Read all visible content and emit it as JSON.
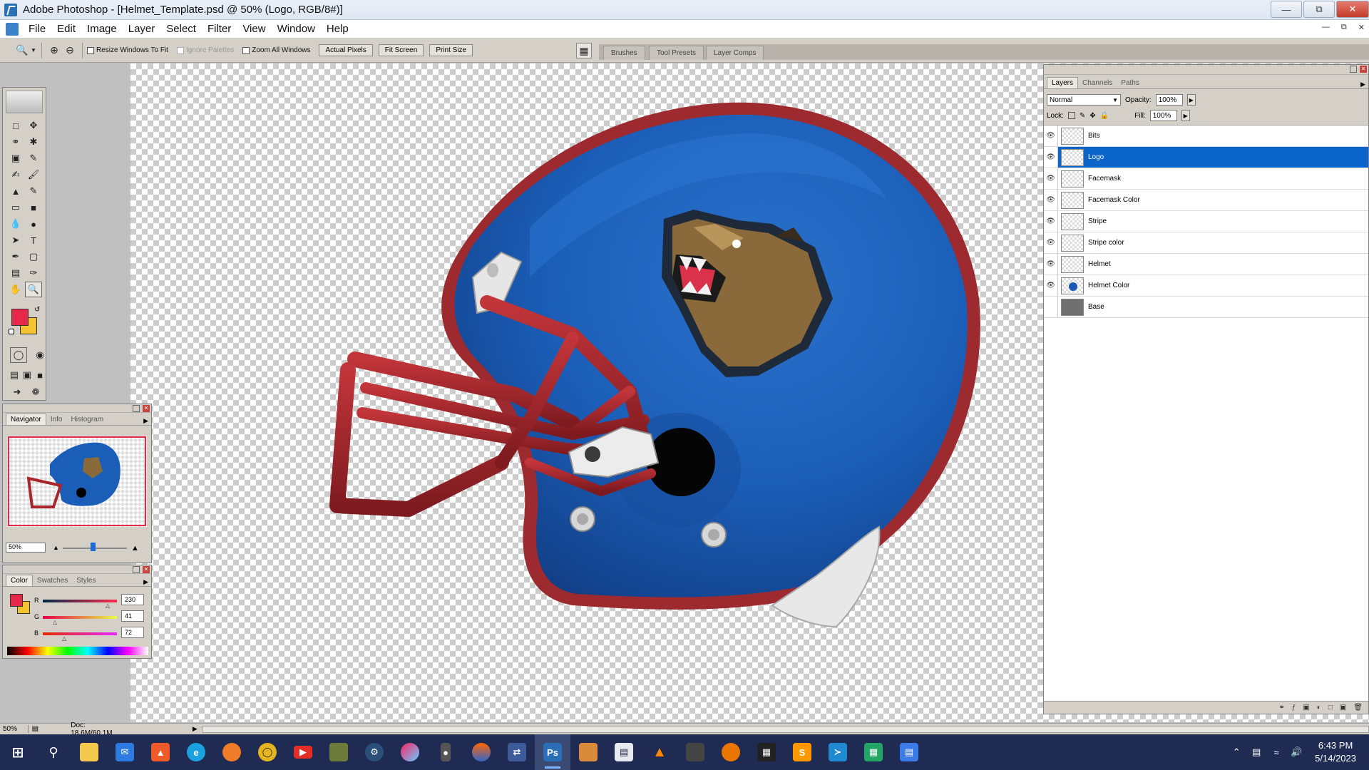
{
  "window": {
    "title": "Adobe Photoshop - [Helmet_Template.psd @ 50% (Logo, RGB/8#)]"
  },
  "menu": [
    "File",
    "Edit",
    "Image",
    "Layer",
    "Select",
    "Filter",
    "View",
    "Window",
    "Help"
  ],
  "options_bar": {
    "checks": [
      {
        "label": "Resize Windows To Fit",
        "enabled": true
      },
      {
        "label": "Ignore Palettes",
        "enabled": false
      },
      {
        "label": "Zoom All Windows",
        "enabled": true
      }
    ],
    "buttons": [
      "Actual Pixels",
      "Fit Screen",
      "Print Size"
    ],
    "palette_well_tabs": [
      "Brushes",
      "Tool Presets",
      "Layer Comps"
    ]
  },
  "navigator": {
    "tabs": [
      "Navigator",
      "Info",
      "Histogram"
    ],
    "zoom": "50%"
  },
  "color_palette": {
    "tabs": [
      "Color",
      "Swatches",
      "Styles"
    ],
    "r_label": "R",
    "g_label": "G",
    "b_label": "B",
    "r": "230",
    "g": "41",
    "b": "72"
  },
  "layers": {
    "tabs": [
      "Layers",
      "Channels",
      "Paths"
    ],
    "blend_mode": "Normal",
    "opacity_label": "Opacity:",
    "opacity": "100%",
    "lock_label": "Lock:",
    "fill_label": "Fill:",
    "fill": "100%",
    "items": [
      {
        "name": "Bits",
        "visible": true,
        "selected": false
      },
      {
        "name": "Logo",
        "visible": true,
        "selected": true
      },
      {
        "name": "Facemask",
        "visible": true,
        "selected": false
      },
      {
        "name": "Facemask Color",
        "visible": true,
        "selected": false
      },
      {
        "name": "Stripe",
        "visible": true,
        "selected": false
      },
      {
        "name": "Stripe color",
        "visible": true,
        "selected": false
      },
      {
        "name": "Helmet",
        "visible": true,
        "selected": false
      },
      {
        "name": "Helmet Color",
        "visible": true,
        "selected": false
      },
      {
        "name": "Base",
        "visible": false,
        "selected": false
      }
    ]
  },
  "statusbar": {
    "zoom": "50%",
    "doc": "Doc: 18.6M/60.1M"
  },
  "colors": {
    "foreground": "#e62948",
    "background": "#f4c430",
    "helmet_blue": "#1b5eb8",
    "facemask_red": "#a8262c",
    "selection_blue": "#0a64c9"
  },
  "taskbar": {
    "time": "6:43 PM",
    "date": "5/14/2023",
    "apps": [
      "file-explorer",
      "mail",
      "brave",
      "edge",
      "firefox",
      "shield-app",
      "youtube",
      "game-app",
      "steam",
      "app-swirl",
      "microphone-app",
      "app-orb",
      "app-arrows",
      "photoshop",
      "paint-app",
      "app-book",
      "vlc",
      "app-cube",
      "blender",
      "app-game2",
      "sublime-text",
      "vscode",
      "sheets",
      "docs"
    ]
  }
}
